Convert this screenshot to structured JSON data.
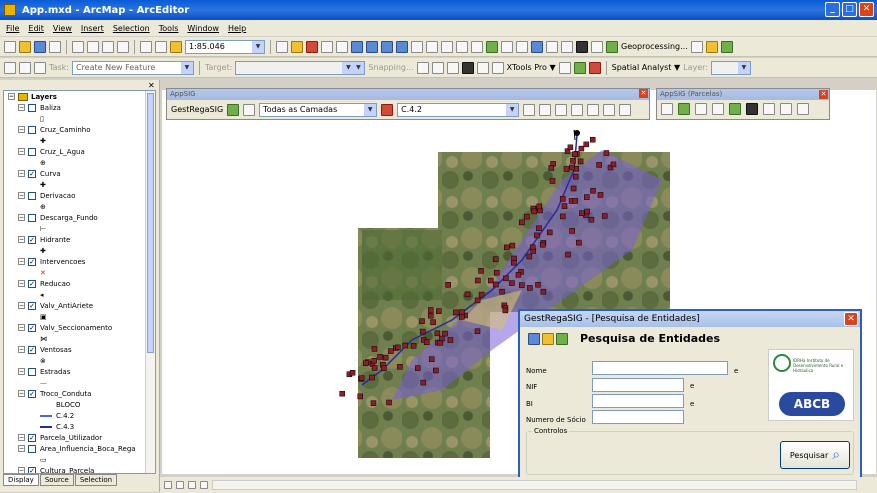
{
  "window": {
    "title": "App.mxd - ArcMap - ArcEditor",
    "minimize": "_",
    "maximize": "□",
    "close": "✕"
  },
  "menu": [
    "File",
    "Edit",
    "View",
    "Insert",
    "Selection",
    "Tools",
    "Window",
    "Help"
  ],
  "toolbar1": {
    "scale": "1:85.046",
    "geoprocessing": "Geoprocessing..."
  },
  "toolbar2": {
    "task_label": "Task:",
    "task_value": "Create New Feature",
    "target_label": "Target:",
    "snapping": "Snapping...",
    "xtools": "XTools Pro ▼",
    "spatial_analyst": "Spatial Analyst ▼",
    "layer_label": "Layer:"
  },
  "toc": {
    "root": "Layers",
    "layers": [
      {
        "name": "Baliza",
        "checked": false,
        "symbol": "▯"
      },
      {
        "name": "Cruz_Caminho",
        "checked": false,
        "symbol": "✚"
      },
      {
        "name": "Cruz_L_Agua",
        "checked": false,
        "symbol": "⊕"
      },
      {
        "name": "Curva",
        "checked": true,
        "symbol": "✚"
      },
      {
        "name": "Derivacao",
        "checked": false,
        "symbol": "⊕"
      },
      {
        "name": "Descarga_Fundo",
        "checked": false,
        "symbol": "⊢"
      },
      {
        "name": "Hidrante",
        "checked": true,
        "symbol": "✚"
      },
      {
        "name": "Intervencoes",
        "checked": true,
        "symbol": "✕"
      },
      {
        "name": "Reducao",
        "checked": true,
        "symbol": "◂"
      },
      {
        "name": "Valv_AntiAriete",
        "checked": true,
        "symbol": "▣"
      },
      {
        "name": "Valv_Seccionamento",
        "checked": true,
        "symbol": "⋈"
      },
      {
        "name": "Ventosas",
        "checked": true,
        "symbol": "⊗"
      },
      {
        "name": "Estradas",
        "checked": false,
        "symbol": "—"
      },
      {
        "name": "Troco_Conduta",
        "checked": true,
        "symbol": ""
      },
      {
        "name": "Parcela_Utilizador",
        "checked": true,
        "symbol": ""
      },
      {
        "name": "Area_Influencia_Boca_Rega",
        "checked": false,
        "symbol": "▭"
      },
      {
        "name": "Cultura_Parcela",
        "checked": true,
        "symbol": ""
      }
    ],
    "troco_items": [
      "BLOCO",
      "C.4.2",
      "C.4.3"
    ],
    "tabs": [
      "Display",
      "Source",
      "Selection"
    ]
  },
  "appsig": {
    "title": "AppSIG",
    "label": "GestRegaSIG",
    "layers_value": "Todas as Camadas",
    "code_value": "C.4.2",
    "parcelas_title": "AppSIG (Parcelas)"
  },
  "dialog": {
    "title": "GestRegaSIG - [Pesquisa de Entidades]",
    "heading": "Pesquisa de Entidades",
    "nome_label": "Nome",
    "nif_label": "NIF",
    "bi_label": "BI",
    "socio_label": "Numero de Sócio",
    "and1": "e",
    "and2": "e",
    "and3": "e",
    "controls_label": "Controlos",
    "search_button": "Pesquisar",
    "logo1_text": "IDRHa Instituto de Desenvolvimento Rural e Hidraulica",
    "logo2_text": "ABCB"
  },
  "colors": {
    "accent": "#2a5fbd",
    "map_points": "#8a1e2a",
    "pipes": "#7a5fd8"
  }
}
